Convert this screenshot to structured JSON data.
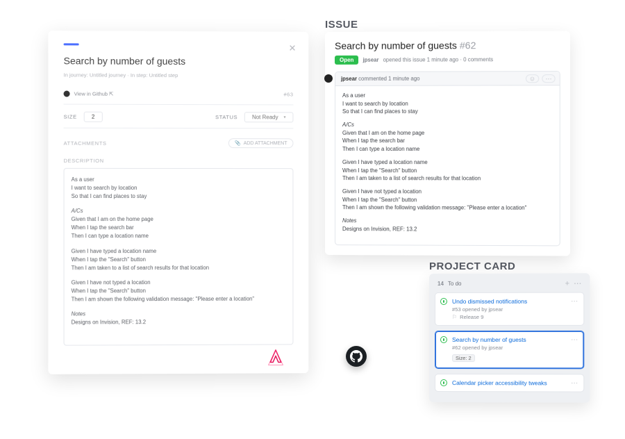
{
  "headings": {
    "issue": "ISSUE",
    "project": "PROJECT CARD"
  },
  "left": {
    "close": "✕",
    "title": "Search by number of guests",
    "crumb1": "In journey: Untitled journey",
    "crumbSep": " · ",
    "crumb2": "In step: Untitled step",
    "ghLink": "View in Github ⇱",
    "ref": "#63",
    "sizeLabel": "SIZE",
    "sizeValue": "2",
    "statusLabel": "STATUS",
    "statusValue": "Not Ready",
    "attachmentsLabel": "ATTACHMENTS",
    "addAttachment": "ADD ATTACHMENT",
    "descriptionLabel": "DESCRIPTION",
    "desc": {
      "p1": "As a user\nI want to search by location\nSo that I can find places to stay",
      "acHead": "A/Cs",
      "p2": "Given that I am on the home page\nWhen I tap the search bar\nThen I can type a location name",
      "p3": "Given I have typed a location name\nWhen I tap the \"Search\" button\nThen I am taken to a list of search results for that location",
      "p4": "Given I have not typed a location\nWhen I tap the \"Search\" button\nThen I am shown the following validation message: \"Please enter a location\"",
      "notesHead": "Notes",
      "p5": "Designs on Invision, REF: 13.2"
    }
  },
  "issue": {
    "title": "Search by number of guests",
    "number": "#62",
    "badge": "Open",
    "metaUser": "jpsear",
    "metaRest": "opened this issue 1 minute ago · 0 comments",
    "commentUser": "jpsear",
    "commentTime": "commented 1 minute ago",
    "body": {
      "p1": "As a user\nI want to search by location\nSo that I can find places to stay",
      "acHead": "A/Cs",
      "p2": "Given that I am on the home page\nWhen I tap the search bar\nThen I can type a location name",
      "p3": "Given I have typed a location name\nWhen I tap the \"Search\" button\nThen I am taken to a list of search results for that location",
      "p4": "Given I have not typed a location\nWhen I tap the \"Search\" button\nThen I am shown the following validation message: \"Please enter a location\"",
      "notesHead": "Notes",
      "p5": "Designs on Invision, REF: 13.2"
    }
  },
  "project": {
    "count": "14",
    "column": "To do",
    "items": [
      {
        "title": "Undo dismissed notifications",
        "sub": "#53 opened by jpsear",
        "extra": "Release 9",
        "sel": false
      },
      {
        "title": "Search by number of guests",
        "sub": "#62 opened by jpsear",
        "extra": "Size: 2",
        "sel": true
      },
      {
        "title": "Calendar picker accessibility tweaks",
        "sub": "",
        "extra": "",
        "sel": false
      }
    ]
  }
}
